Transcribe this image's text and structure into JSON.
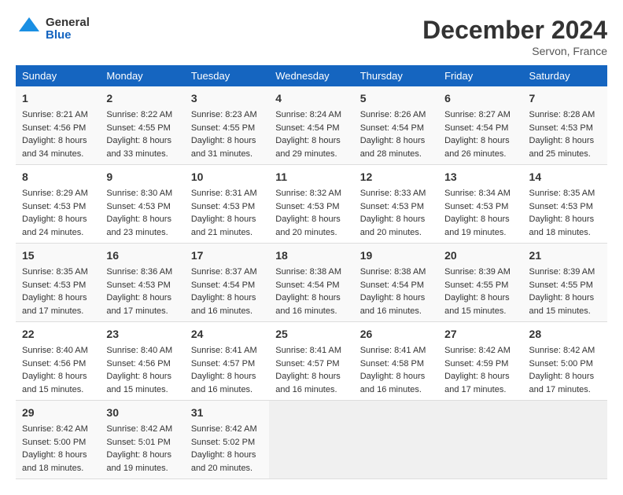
{
  "header": {
    "logo_line1": "General",
    "logo_line2": "Blue",
    "title": "December 2024",
    "location": "Servon, France"
  },
  "days_of_week": [
    "Sunday",
    "Monday",
    "Tuesday",
    "Wednesday",
    "Thursday",
    "Friday",
    "Saturday"
  ],
  "weeks": [
    [
      {
        "day": "1",
        "sunrise": "8:21 AM",
        "sunset": "4:56 PM",
        "daylight": "8 hours and 34 minutes."
      },
      {
        "day": "2",
        "sunrise": "8:22 AM",
        "sunset": "4:55 PM",
        "daylight": "8 hours and 33 minutes."
      },
      {
        "day": "3",
        "sunrise": "8:23 AM",
        "sunset": "4:55 PM",
        "daylight": "8 hours and 31 minutes."
      },
      {
        "day": "4",
        "sunrise": "8:24 AM",
        "sunset": "4:54 PM",
        "daylight": "8 hours and 29 minutes."
      },
      {
        "day": "5",
        "sunrise": "8:26 AM",
        "sunset": "4:54 PM",
        "daylight": "8 hours and 28 minutes."
      },
      {
        "day": "6",
        "sunrise": "8:27 AM",
        "sunset": "4:54 PM",
        "daylight": "8 hours and 26 minutes."
      },
      {
        "day": "7",
        "sunrise": "8:28 AM",
        "sunset": "4:53 PM",
        "daylight": "8 hours and 25 minutes."
      }
    ],
    [
      {
        "day": "8",
        "sunrise": "8:29 AM",
        "sunset": "4:53 PM",
        "daylight": "8 hours and 24 minutes."
      },
      {
        "day": "9",
        "sunrise": "8:30 AM",
        "sunset": "4:53 PM",
        "daylight": "8 hours and 23 minutes."
      },
      {
        "day": "10",
        "sunrise": "8:31 AM",
        "sunset": "4:53 PM",
        "daylight": "8 hours and 21 minutes."
      },
      {
        "day": "11",
        "sunrise": "8:32 AM",
        "sunset": "4:53 PM",
        "daylight": "8 hours and 20 minutes."
      },
      {
        "day": "12",
        "sunrise": "8:33 AM",
        "sunset": "4:53 PM",
        "daylight": "8 hours and 20 minutes."
      },
      {
        "day": "13",
        "sunrise": "8:34 AM",
        "sunset": "4:53 PM",
        "daylight": "8 hours and 19 minutes."
      },
      {
        "day": "14",
        "sunrise": "8:35 AM",
        "sunset": "4:53 PM",
        "daylight": "8 hours and 18 minutes."
      }
    ],
    [
      {
        "day": "15",
        "sunrise": "8:35 AM",
        "sunset": "4:53 PM",
        "daylight": "8 hours and 17 minutes."
      },
      {
        "day": "16",
        "sunrise": "8:36 AM",
        "sunset": "4:53 PM",
        "daylight": "8 hours and 17 minutes."
      },
      {
        "day": "17",
        "sunrise": "8:37 AM",
        "sunset": "4:54 PM",
        "daylight": "8 hours and 16 minutes."
      },
      {
        "day": "18",
        "sunrise": "8:38 AM",
        "sunset": "4:54 PM",
        "daylight": "8 hours and 16 minutes."
      },
      {
        "day": "19",
        "sunrise": "8:38 AM",
        "sunset": "4:54 PM",
        "daylight": "8 hours and 16 minutes."
      },
      {
        "day": "20",
        "sunrise": "8:39 AM",
        "sunset": "4:55 PM",
        "daylight": "8 hours and 15 minutes."
      },
      {
        "day": "21",
        "sunrise": "8:39 AM",
        "sunset": "4:55 PM",
        "daylight": "8 hours and 15 minutes."
      }
    ],
    [
      {
        "day": "22",
        "sunrise": "8:40 AM",
        "sunset": "4:56 PM",
        "daylight": "8 hours and 15 minutes."
      },
      {
        "day": "23",
        "sunrise": "8:40 AM",
        "sunset": "4:56 PM",
        "daylight": "8 hours and 15 minutes."
      },
      {
        "day": "24",
        "sunrise": "8:41 AM",
        "sunset": "4:57 PM",
        "daylight": "8 hours and 16 minutes."
      },
      {
        "day": "25",
        "sunrise": "8:41 AM",
        "sunset": "4:57 PM",
        "daylight": "8 hours and 16 minutes."
      },
      {
        "day": "26",
        "sunrise": "8:41 AM",
        "sunset": "4:58 PM",
        "daylight": "8 hours and 16 minutes."
      },
      {
        "day": "27",
        "sunrise": "8:42 AM",
        "sunset": "4:59 PM",
        "daylight": "8 hours and 17 minutes."
      },
      {
        "day": "28",
        "sunrise": "8:42 AM",
        "sunset": "5:00 PM",
        "daylight": "8 hours and 17 minutes."
      }
    ],
    [
      {
        "day": "29",
        "sunrise": "8:42 AM",
        "sunset": "5:00 PM",
        "daylight": "8 hours and 18 minutes."
      },
      {
        "day": "30",
        "sunrise": "8:42 AM",
        "sunset": "5:01 PM",
        "daylight": "8 hours and 19 minutes."
      },
      {
        "day": "31",
        "sunrise": "8:42 AM",
        "sunset": "5:02 PM",
        "daylight": "8 hours and 20 minutes."
      },
      null,
      null,
      null,
      null
    ]
  ],
  "labels": {
    "sunrise": "Sunrise:",
    "sunset": "Sunset:",
    "daylight": "Daylight:"
  }
}
